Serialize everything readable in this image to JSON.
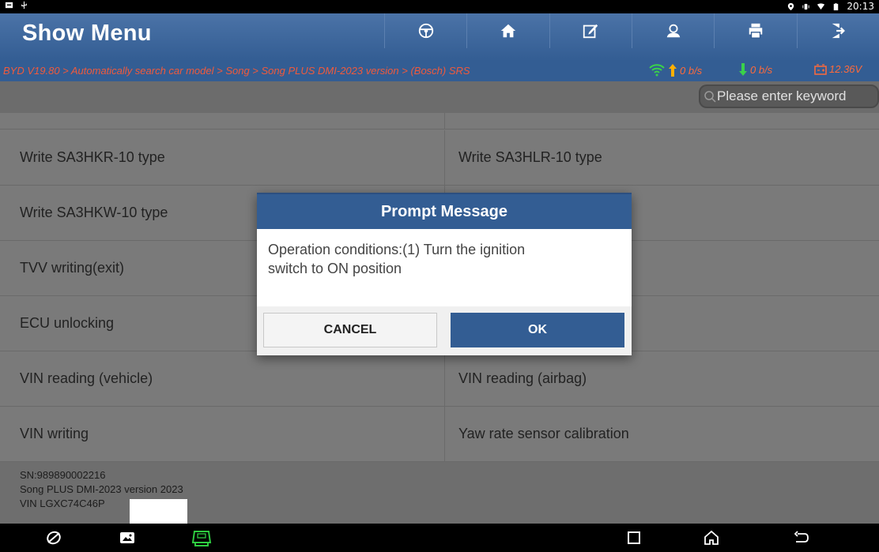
{
  "status_bar": {
    "time": "20:13",
    "left_icons": [
      "notification-icon",
      "usb-icon"
    ],
    "right_icons": [
      "location-icon",
      "vibrate-icon",
      "wifi-icon",
      "battery-icon"
    ]
  },
  "header": {
    "title": "Show Menu",
    "toolbar": [
      "steering-wheel-icon",
      "home-icon",
      "edit-report-icon",
      "user-icon",
      "print-icon",
      "exit-icon"
    ]
  },
  "breadcrumb": {
    "path": "BYD V19.80 > Automatically search car model > Song > Song PLUS DMI-2023 version > (Bosch) SRS",
    "upload_rate": "0 b/s",
    "download_rate": "0 b/s",
    "voltage": "12.36V"
  },
  "search": {
    "placeholder": "Please enter keyword"
  },
  "menu_items": [
    [
      "Write SA3HKR-10 type",
      "Write SA3HLR-10 type"
    ],
    [
      "Write SA3HKW-10 type",
      ""
    ],
    [
      "TVV writing(exit)",
      ""
    ],
    [
      "ECU unlocking",
      ""
    ],
    [
      "VIN reading (vehicle)",
      "VIN reading (airbag)"
    ],
    [
      "VIN writing",
      "Yaw rate sensor calibration"
    ]
  ],
  "footer": {
    "sn": "SN:989890002216",
    "model": "Song PLUS DMI-2023 version 2023",
    "vin": "VIN LGXC74C46P"
  },
  "dialog": {
    "title": "Prompt Message",
    "message": "Operation conditions:(1) Turn the ignition\nswitch to ON position",
    "cancel_label": "CANCEL",
    "ok_label": "OK"
  },
  "colors": {
    "header_blue": "#335d93",
    "breadcrumb_text": "#f05a3c",
    "speed_icon": "#3ad14a",
    "vci_icon": "#2ecc40"
  }
}
